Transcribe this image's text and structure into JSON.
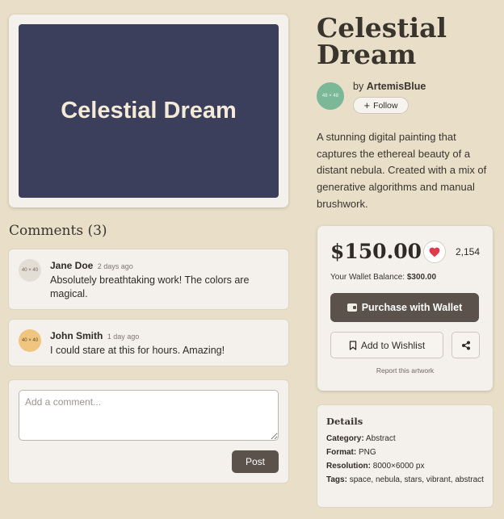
{
  "artwork": {
    "title": "Celestial Dream",
    "image_label": "Celestial Dream"
  },
  "artist": {
    "by_prefix": "by",
    "name": "ArtemisBlue",
    "avatar_placeholder": "48 × 48",
    "follow_label": "Follow"
  },
  "description": "A stunning digital painting that captures the ethereal beauty of a distant nebula. Created with a mix of generative algorithms and manual brushwork.",
  "comments": {
    "heading": "Comments (3)",
    "items": [
      {
        "author": "Jane Doe",
        "time": "2 days ago",
        "text": "Absolutely breathtaking work! The colors are magical.",
        "avatar_placeholder": "40 × 40"
      },
      {
        "author": "John Smith",
        "time": "1 day ago",
        "text": "I could stare at this for hours. Amazing!",
        "avatar_placeholder": "40 × 40"
      }
    ],
    "input_placeholder": "Add a comment...",
    "post_label": "Post"
  },
  "purchase": {
    "price": "$150.00",
    "likes": "2,154",
    "wallet_label": "Your Wallet Balance:",
    "wallet_balance": "$300.00",
    "purchase_label": "Purchase with Wallet",
    "wishlist_label": "Add to Wishlist",
    "report_label": "Report this artwork"
  },
  "details": {
    "heading": "Details",
    "category_label": "Category:",
    "category": "Abstract",
    "format_label": "Format:",
    "format": "PNG",
    "resolution_label": "Resolution:",
    "resolution": "8000×6000 px",
    "tags_label": "Tags:",
    "tags": "space, nebula, stars, vibrant, abstract"
  },
  "colors": {
    "background": "#e9dfc8",
    "artwork_fill": "#3b3f5c",
    "primary_button": "#5a524b",
    "heart": "#e03a4e",
    "artist_avatar": "#7bb898"
  },
  "icons": {
    "like": "heart-icon",
    "wallet": "wallet-icon",
    "wishlist": "bookmark-icon",
    "share": "share-icon",
    "follow": "plus-icon"
  }
}
